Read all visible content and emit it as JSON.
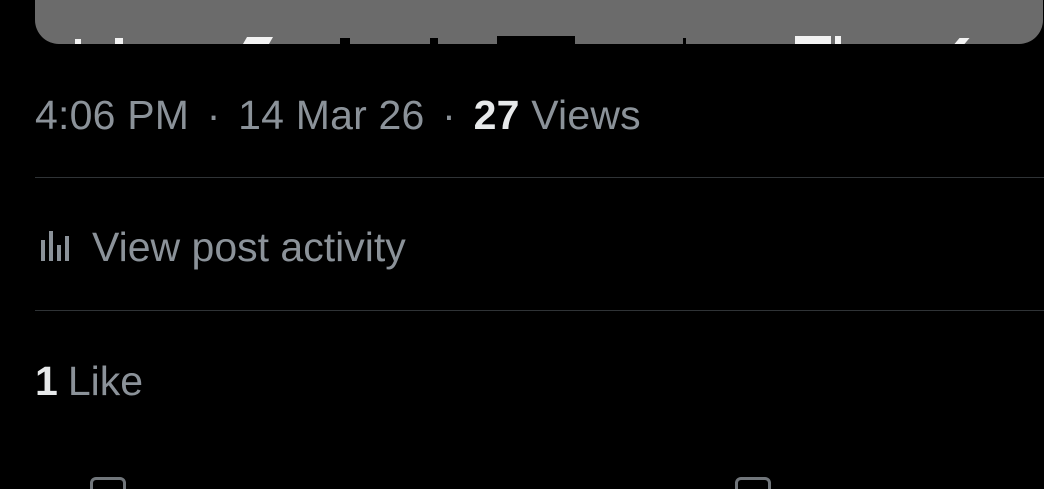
{
  "post_meta": {
    "time": "4:06 PM",
    "separator_1": "·",
    "date": "14 Mar 26",
    "separator_2": "·",
    "views_count": "27",
    "views_label": "Views"
  },
  "activity": {
    "icon": "analytics-bar-chart-icon",
    "label": "View post activity"
  },
  "likes": {
    "count": "1",
    "label": "Like"
  },
  "colors": {
    "background": "#000000",
    "muted_text": "#8b9299",
    "strong_text": "#e7e9ea",
    "divider": "#2f3336",
    "media_card": "#6b6b6b"
  }
}
